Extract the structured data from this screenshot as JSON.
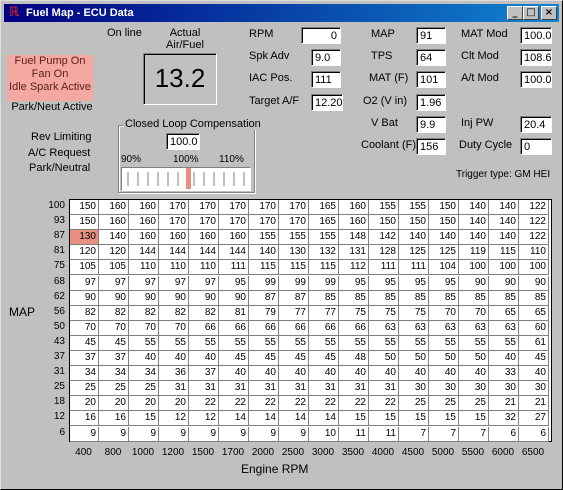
{
  "window": {
    "title": "Fuel Map - ECU Data",
    "min": "_",
    "max": "□",
    "close": "×"
  },
  "left_panel": {
    "online_label": "On line",
    "actual_afr_label": "Actual Air/Fuel",
    "actual_afr_value": "13.2",
    "status_items": [
      "Fuel Pump On",
      "Fan On",
      "Idle Spark Active",
      "Park/Neut Active"
    ],
    "indicators": [
      "Rev Limiting",
      "A/C Request",
      "Park/Neutral"
    ]
  },
  "clc": {
    "title": "Closed Loop Compensation",
    "value": "100.0",
    "ticks": [
      "90%",
      "100%",
      "110%"
    ],
    "position_pct": 100
  },
  "fields_col1": [
    {
      "label": "RPM",
      "value": "0"
    },
    {
      "label": "Spk Adv",
      "value": "9.0"
    },
    {
      "label": "IAC Pos.",
      "value": "111"
    },
    {
      "label": "Target A/F",
      "value": "12.20"
    }
  ],
  "fields_col2": [
    {
      "label": "MAP",
      "value": "91"
    },
    {
      "label": "TPS",
      "value": "64"
    },
    {
      "label": "MAT (F)",
      "value": "101"
    },
    {
      "label": "O2 (V in)",
      "value": "1.96"
    },
    {
      "label": "V Bat",
      "value": "9.9"
    },
    {
      "label": "Coolant (F)",
      "value": "156"
    }
  ],
  "fields_col3": [
    {
      "label": "MAT Mod",
      "value": "100.0"
    },
    {
      "label": "Clt Mod",
      "value": "108.6"
    },
    {
      "label": "A/t Mod",
      "value": "100.0"
    },
    {
      "label": "Inj PW",
      "value": "20.4"
    },
    {
      "label": "Duty Cycle",
      "value": "0"
    }
  ],
  "trigger_type": "Trigger type: GM HEI",
  "table": {
    "y_axis_title": "MAP",
    "x_axis_title": "Engine RPM",
    "map_rows": [
      "100",
      "93",
      "87",
      "81",
      "75",
      "68",
      "62",
      "56",
      "50",
      "43",
      "37",
      "31",
      "25",
      "18",
      "12",
      "6"
    ],
    "rpm_cols": [
      "400",
      "800",
      "1000",
      "1200",
      "1500",
      "1700",
      "2000",
      "2500",
      "3000",
      "3500",
      "4000",
      "4500",
      "5000",
      "5500",
      "6000",
      "6500"
    ],
    "highlight": [
      2,
      0
    ],
    "values": [
      [
        "150",
        "160",
        "160",
        "170",
        "170",
        "170",
        "170",
        "170",
        "165",
        "160",
        "155",
        "155",
        "150",
        "140",
        "140",
        "122"
      ],
      [
        "150",
        "160",
        "160",
        "170",
        "170",
        "170",
        "170",
        "170",
        "165",
        "160",
        "150",
        "150",
        "150",
        "140",
        "140",
        "122"
      ],
      [
        "130",
        "140",
        "160",
        "160",
        "160",
        "160",
        "155",
        "155",
        "155",
        "148",
        "142",
        "140",
        "140",
        "140",
        "140",
        "122"
      ],
      [
        "120",
        "120",
        "144",
        "144",
        "144",
        "144",
        "140",
        "130",
        "132",
        "131",
        "128",
        "125",
        "125",
        "119",
        "115",
        "110"
      ],
      [
        "105",
        "105",
        "110",
        "110",
        "110",
        "111",
        "115",
        "115",
        "115",
        "112",
        "111",
        "111",
        "104",
        "100",
        "100",
        "100"
      ],
      [
        "97",
        "97",
        "97",
        "97",
        "97",
        "95",
        "99",
        "99",
        "99",
        "95",
        "95",
        "95",
        "95",
        "90",
        "90",
        "90"
      ],
      [
        "90",
        "90",
        "90",
        "90",
        "90",
        "90",
        "87",
        "87",
        "85",
        "85",
        "85",
        "85",
        "85",
        "85",
        "85",
        "85"
      ],
      [
        "82",
        "82",
        "82",
        "82",
        "82",
        "81",
        "79",
        "77",
        "77",
        "75",
        "75",
        "75",
        "70",
        "70",
        "65",
        "65"
      ],
      [
        "70",
        "70",
        "70",
        "70",
        "66",
        "66",
        "66",
        "66",
        "66",
        "66",
        "63",
        "63",
        "63",
        "63",
        "63",
        "60"
      ],
      [
        "45",
        "45",
        "55",
        "55",
        "55",
        "55",
        "55",
        "55",
        "55",
        "55",
        "55",
        "55",
        "55",
        "55",
        "55",
        "61"
      ],
      [
        "37",
        "37",
        "40",
        "40",
        "40",
        "45",
        "45",
        "45",
        "45",
        "48",
        "50",
        "50",
        "50",
        "50",
        "40",
        "45"
      ],
      [
        "34",
        "34",
        "34",
        "36",
        "37",
        "40",
        "40",
        "40",
        "40",
        "40",
        "40",
        "40",
        "40",
        "40",
        "33",
        "40"
      ],
      [
        "25",
        "25",
        "25",
        "31",
        "31",
        "31",
        "31",
        "31",
        "31",
        "31",
        "31",
        "30",
        "30",
        "30",
        "30",
        "30"
      ],
      [
        "20",
        "20",
        "20",
        "20",
        "22",
        "22",
        "22",
        "22",
        "22",
        "22",
        "22",
        "25",
        "25",
        "25",
        "21",
        "21"
      ],
      [
        "16",
        "16",
        "15",
        "12",
        "12",
        "14",
        "14",
        "14",
        "14",
        "15",
        "15",
        "15",
        "15",
        "15",
        "32",
        "27"
      ],
      [
        "9",
        "9",
        "9",
        "9",
        "9",
        "9",
        "9",
        "9",
        "10",
        "11",
        "11",
        "7",
        "7",
        "7",
        "6",
        "6"
      ]
    ]
  }
}
